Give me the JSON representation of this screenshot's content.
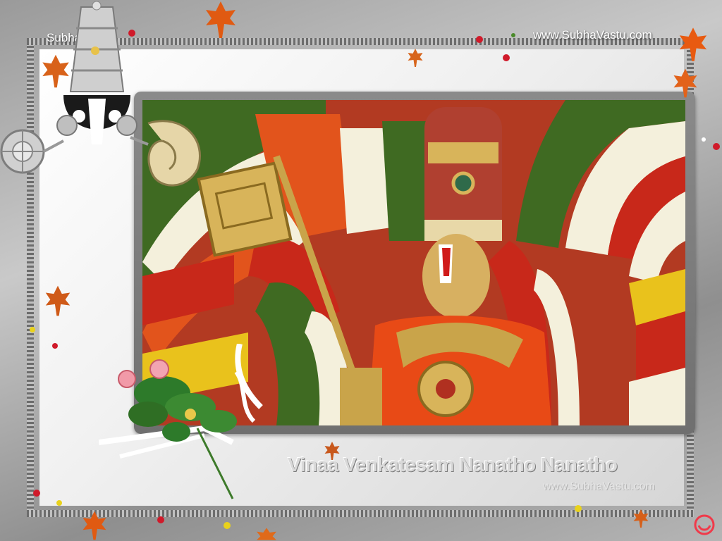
{
  "brand": {
    "logo_text": "SubhaVastu"
  },
  "header": {
    "url": "www.SubhaVastu.com"
  },
  "caption": {
    "text": "Vinaa Venkatesam Nanatho Nanatho"
  },
  "watermark": {
    "text": "www.SubhaVastu.com"
  },
  "colors": {
    "frame_gray": "#8a8a8a",
    "flower_red": "#c8281a",
    "flower_orange": "#e2541c",
    "flower_white": "#f4f0dc",
    "flower_yellow": "#e9c21c",
    "leaf_green": "#3f6a22",
    "gold": "#c9a44a"
  },
  "icons": [
    "maple-leaf-icon",
    "rose-bouquet-icon",
    "conch-icon",
    "chakra-icon",
    "smiley-icon"
  ]
}
